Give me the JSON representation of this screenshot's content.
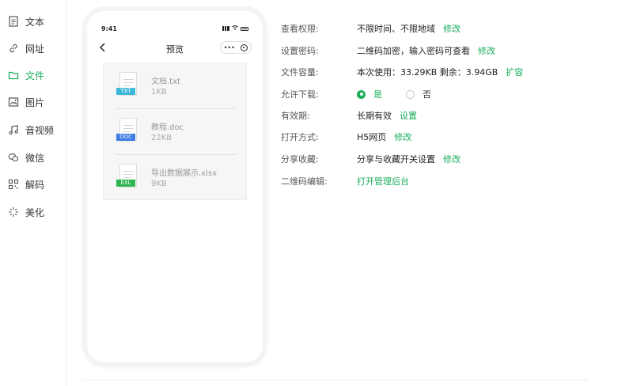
{
  "colors": {
    "accent": "#1aad5c",
    "txt_tag": "#3cb8d6",
    "doc_tag": "#3c7be6",
    "exl_tag": "#2eb54f"
  },
  "sidebar": {
    "items": [
      {
        "label": "文本",
        "icon": "document-icon"
      },
      {
        "label": "网址",
        "icon": "link-icon"
      },
      {
        "label": "文件",
        "icon": "folder-icon",
        "active": true
      },
      {
        "label": "图片",
        "icon": "image-icon"
      },
      {
        "label": "音视频",
        "icon": "music-icon"
      },
      {
        "label": "微信",
        "icon": "wechat-icon"
      },
      {
        "label": "解码",
        "icon": "qr-scan-icon"
      },
      {
        "label": "美化",
        "icon": "sparkle-icon"
      }
    ]
  },
  "phone": {
    "time": "9:41",
    "nav_title": "预览",
    "capsule_more": "•••",
    "files": [
      {
        "tag": "TXT",
        "name": "文档.txt",
        "size": "1KB"
      },
      {
        "tag": "DOC",
        "name": "教程.doc",
        "size": "22KB"
      },
      {
        "tag": "EXL",
        "name": "导出数据展示.xlsx",
        "size": "9KB"
      }
    ]
  },
  "settings": {
    "view_permission": {
      "label": "查看权限:",
      "value": "不限时间、不限地域",
      "action": "修改"
    },
    "password": {
      "label": "设置密码:",
      "value": "二维码加密，输入密码可查看",
      "action": "修改"
    },
    "capacity": {
      "label": "文件容量:",
      "value": "本次使用：33.29KB 剩余：3.94GB",
      "action": "扩容"
    },
    "download": {
      "label": "允许下载:",
      "yes": "是",
      "no": "否"
    },
    "validity": {
      "label": "有效期:",
      "value": "长期有效",
      "action": "设置"
    },
    "open_mode": {
      "label": "打开方式:",
      "value": "H5网页",
      "action": "修改"
    },
    "share": {
      "label": "分享收藏:",
      "value": "分享与收藏开关设置",
      "action": "修改"
    },
    "qr_edit": {
      "label": "二维码编辑:",
      "action": "打开管理后台"
    }
  }
}
